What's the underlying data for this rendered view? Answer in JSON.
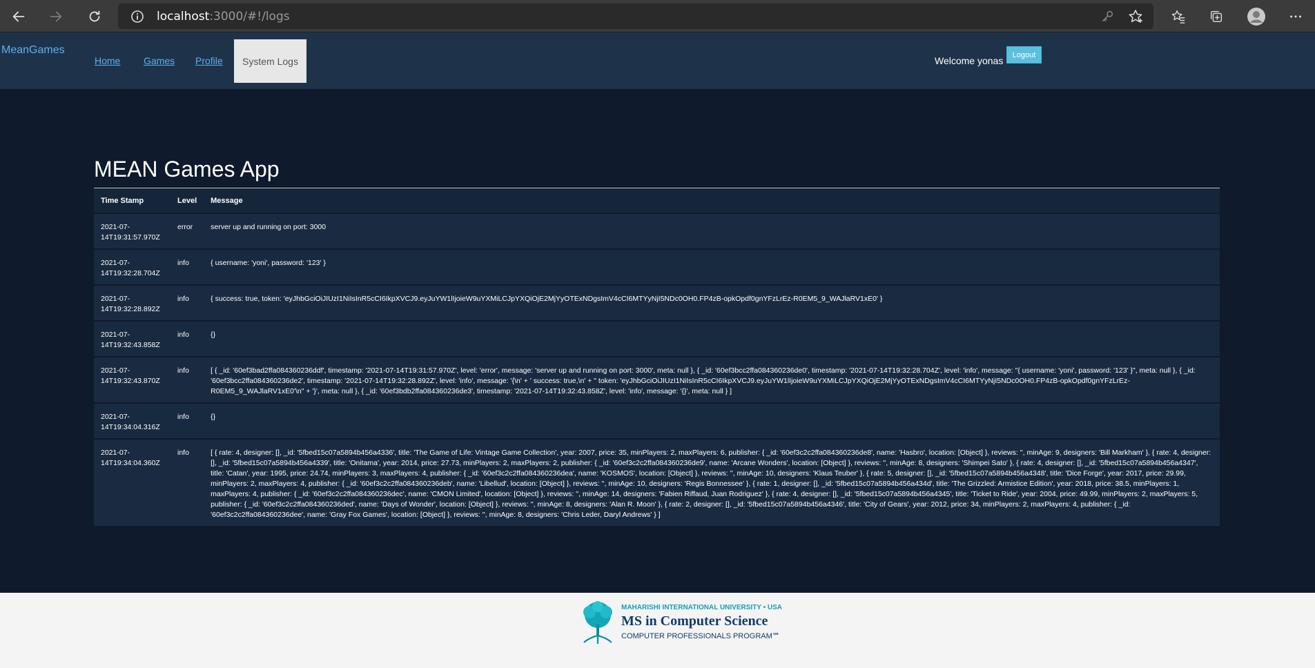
{
  "browser": {
    "url_host": "localhost",
    "url_path": ":3000/#!/logs"
  },
  "nav": {
    "brand": "MeanGames",
    "links": [
      "Home",
      "Games",
      "Profile"
    ],
    "active": "System Logs",
    "welcome": "Welcome yonas",
    "logout": "Logout"
  },
  "main": {
    "title": "MEAN Games App",
    "columns": [
      "Time Stamp",
      "Level",
      "Message"
    ],
    "rows": [
      {
        "ts": "2021-07-14T19:31:57.970Z",
        "level": "error",
        "message": "server up and running on port: 3000"
      },
      {
        "ts": "2021-07-14T19:32:28.704Z",
        "level": "info",
        "message": "{ username: 'yoni', password: '123' }"
      },
      {
        "ts": "2021-07-14T19:32:28.892Z",
        "level": "info",
        "message": "{ success: true, token: 'eyJhbGciOiJIUzI1NiIsInR5cCI6IkpXVCJ9.eyJuYW1lIjoieW9uYXMiLCJpYXQiOjE2MjYyOTExNDgsImV4cCI6MTYyNjI5NDc0OH0.FP4zB-opkOpdf0gnYFzLrEz-R0EM5_9_WAJlaRV1xE0' }"
      },
      {
        "ts": "2021-07-14T19:32:43.858Z",
        "level": "info",
        "message": "{}"
      },
      {
        "ts": "2021-07-14T19:32:43.870Z",
        "level": "info",
        "message": "[ { _id: '60ef3bad2ffa084360236ddf', timestamp: '2021-07-14T19:31:57.970Z', level: 'error', message: 'server up and running on port: 3000', meta: null }, { _id: '60ef3bcc2ffa084360236de0', timestamp: '2021-07-14T19:32:28.704Z', level: 'info', message: \"{ username: 'yoni', password: '123' }\", meta: null }, { _id: '60ef3bcc2ffa084360236de2', timestamp: '2021-07-14T19:32:28.892Z', level: 'info', message: '{\\n' + ' success: true,\\n' + \" token: 'eyJhbGciOiJIUzI1NiIsInR5cCI6IkpXVCJ9.eyJuYW1lIjoieW9uYXMiLCJpYXQiOjE2MjYyOTExNDgsImV4cCI6MTYyNjI5NDc0OH0.FP4zB-opkOpdf0gnYFzLrEz-R0EM5_9_WAJlaRV1xE0'\\n\" + '}', meta: null }, { _id: '60ef3bdb2ffa084360236de3', timestamp: '2021-07-14T19:32:43.858Z', level: 'info', message: '{}', meta: null } ]"
      },
      {
        "ts": "2021-07-14T19:34:04.316Z",
        "level": "info",
        "message": "{}"
      },
      {
        "ts": "2021-07-14T19:34:04.360Z",
        "level": "info",
        "message": "[ { rate: 4, designer: [], _id: '5fbed15c07a5894b456a4336', title: 'The Game of Life: Vintage Game Collection', year: 2007, price: 35, minPlayers: 2, maxPlayers: 6, publisher: { _id: '60ef3c2c2ffa084360236de8', name: 'Hasbro', location: [Object] }, reviews: '', minAge: 9, designers: 'Bill Markham' }, { rate: 4, designer: [], _id: '5fbed15c07a5894b456a4339', title: 'Onitama', year: 2014, price: 27.73, minPlayers: 2, maxPlayers: 2, publisher: { _id: '60ef3c2c2ffa084360236de9', name: 'Arcane Wonders', location: [Object] }, reviews: '', minAge: 8, designers: 'Shimpei Sato' }, { rate: 4, designer: [], _id: '5fbed15c07a5894b456a4347', title: 'Catan', year: 1995, price: 24.74, minPlayers: 3, maxPlayers: 4, publisher: { _id: '60ef3c2c2ffa084360236dea', name: 'KOSMOS', location: [Object] }, reviews: '', minAge: 10, designers: 'Klaus Teuber' }, { rate: 5, designer: [], _id: '5fbed15c07a5894b456a4348', title: 'Dice Forge', year: 2017, price: 29.99, minPlayers: 2, maxPlayers: 4, publisher: { _id: '60ef3c2c2ffa084360236deb', name: 'Libellud', location: [Object] }, reviews: '', minAge: 10, designers: 'Regis Bonnessee' }, { rate: 1, designer: [], _id: '5fbed15c07a5894b456a434d', title: 'The Grizzled: Armistice Edition', year: 2018, price: 38.5, minPlayers: 1, maxPlayers: 4, publisher: { _id: '60ef3c2c2ffa084360236dec', name: 'CMON Limited', location: [Object] }, reviews: '', minAge: 14, designers: 'Fabien Riffaud, Juan Rodriguez' }, { rate: 4, designer: [], _id: '5fbed15c07a5894b456a4345', title: 'Ticket to Ride', year: 2004, price: 49.99, minPlayers: 2, maxPlayers: 5, publisher: { _id: '60ef3c2c2ffa084360236ded', name: 'Days of Wonder', location: [Object] }, reviews: '', minAge: 8, designers: 'Alan R. Moon' }, { rate: 2, designer: [], _id: '5fbed15c07a5894b456a4346', title: 'City of Gears', year: 2012, price: 34, minPlayers: 2, maxPlayers: 4, publisher: { _id: '60ef3c2c2ffa084360236dee', name: 'Gray Fox Games', location: [Object] }, reviews: '', minAge: 8, designers: 'Chris Leder, Daryl Andrews' } ]"
      }
    ]
  },
  "footer": {
    "university": "MAHARISHI INTERNATIONAL UNIVERSITY • USA",
    "program": "MS in Computer Science",
    "subtitle": "COMPUTER PROFESSIONALS PROGRAM℠"
  },
  "colors": {
    "page_bg": "#0f1a2c",
    "nav_bg": "#1e334a",
    "link": "#5fb0ee",
    "logout_bg": "#5bc0de",
    "footer_bg": "#f4f4f4"
  }
}
